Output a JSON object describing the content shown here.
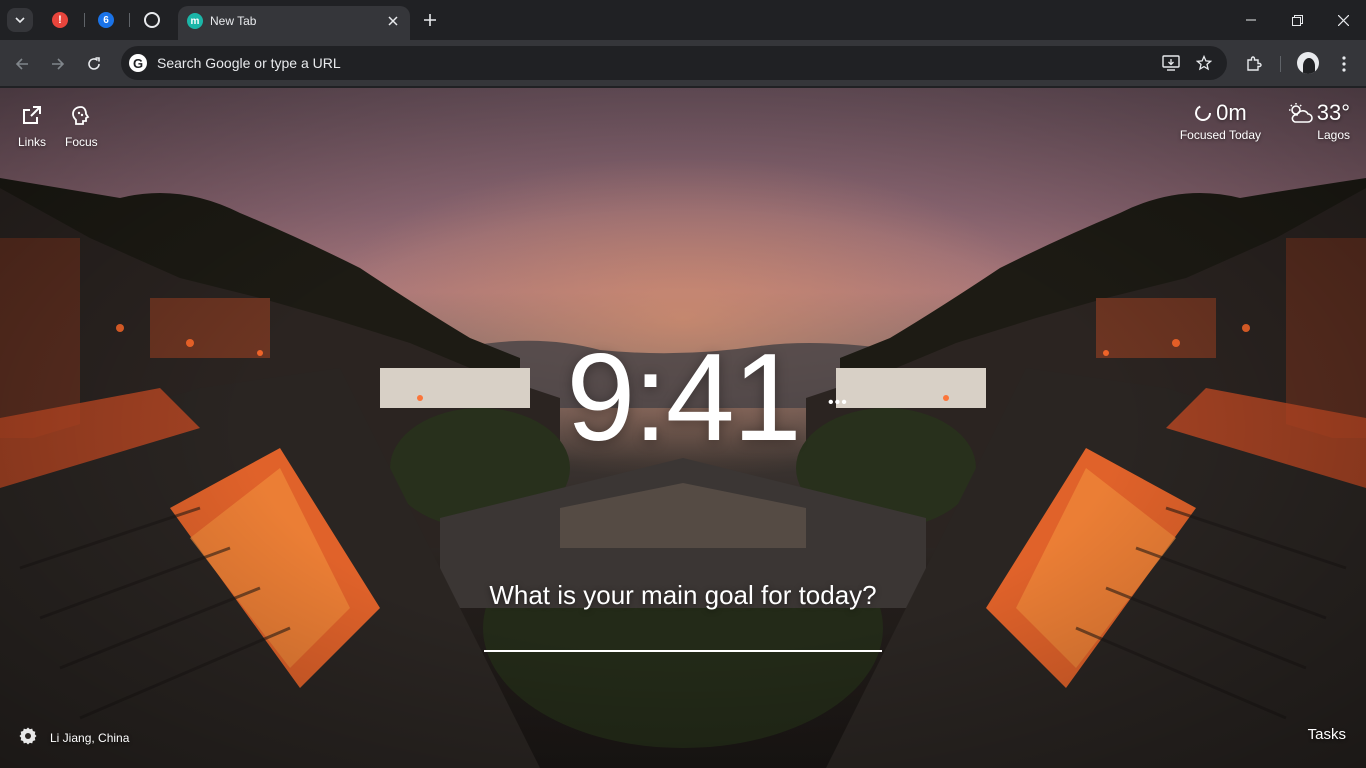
{
  "tabs": {
    "pinned": [
      {
        "name": "alert-tab",
        "badge": "!"
      },
      {
        "name": "count-tab",
        "badge": "6"
      },
      {
        "name": "chatgpt-tab",
        "badge": ""
      }
    ],
    "active": {
      "title": "New Tab",
      "favicon_letter": "m"
    }
  },
  "omnibox": {
    "placeholder": "Search Google or type a URL",
    "value": "",
    "g_logo": "G"
  },
  "momentum": {
    "links_label": "Links",
    "focus_label": "Focus",
    "focused_value": "0m",
    "focused_label": "Focused Today",
    "temperature": "33°",
    "city": "Lagos",
    "clock": "9:41",
    "clock_more": "•••",
    "goal_question": "What is your main goal for today?",
    "goal_value": "",
    "photo_location": "Li Jiang, China",
    "tasks_label": "Tasks"
  },
  "colors": {
    "chrome_dark": "#202124",
    "chrome_toolbar": "#35363a",
    "accent_red": "#e8453c",
    "accent_blue": "#1a73e8",
    "momentum_favicon": "#1bb6a8"
  }
}
